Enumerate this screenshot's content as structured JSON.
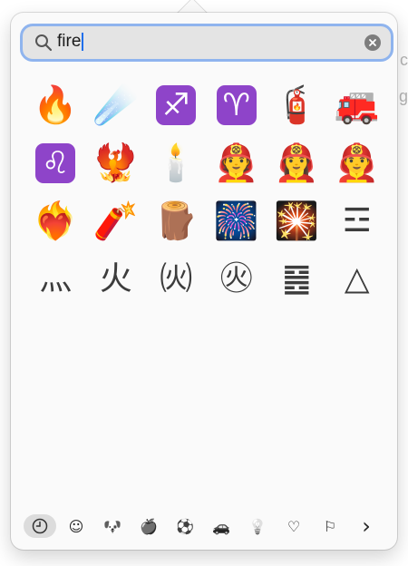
{
  "background": {
    "chars": [
      "c",
      "g"
    ]
  },
  "search": {
    "value": "fire"
  },
  "results": [
    {
      "name": "fire-emoji",
      "glyph": "🔥",
      "kind": "emoji"
    },
    {
      "name": "comet-emoji",
      "glyph": "☄️",
      "kind": "emoji"
    },
    {
      "name": "sagittarius-emoji",
      "glyph": "♐",
      "kind": "box",
      "color": "#8e44c9"
    },
    {
      "name": "aries-emoji",
      "glyph": "♈",
      "kind": "box",
      "color": "#8e44c9"
    },
    {
      "name": "fire-extinguisher-emoji",
      "glyph": "🧯",
      "kind": "emoji"
    },
    {
      "name": "fire-engine-emoji",
      "glyph": "🚒",
      "kind": "emoji"
    },
    {
      "name": "leo-emoji",
      "glyph": "♌",
      "kind": "box",
      "color": "#8e44c9"
    },
    {
      "name": "phoenix-emoji",
      "glyph": "🐦‍🔥",
      "kind": "emoji"
    },
    {
      "name": "candle-emoji",
      "glyph": "🕯️",
      "kind": "emoji"
    },
    {
      "name": "firefighter-emoji",
      "glyph": "🧑‍🚒",
      "kind": "emoji"
    },
    {
      "name": "woman-firefighter-emoji",
      "glyph": "👩‍🚒",
      "kind": "emoji"
    },
    {
      "name": "man-firefighter-emoji",
      "glyph": "👨‍🚒",
      "kind": "emoji"
    },
    {
      "name": "heart-on-fire-emoji",
      "glyph": "❤️‍🔥",
      "kind": "emoji"
    },
    {
      "name": "firecracker-emoji",
      "glyph": "🧨",
      "kind": "emoji"
    },
    {
      "name": "wood-emoji",
      "glyph": "🪵",
      "kind": "emoji"
    },
    {
      "name": "fireworks-emoji",
      "glyph": "🎆",
      "kind": "emoji"
    },
    {
      "name": "sparkler-emoji",
      "glyph": "🎇",
      "kind": "emoji"
    },
    {
      "name": "trigram-for-fire",
      "glyph": "☲",
      "kind": "sym"
    },
    {
      "name": "kangxi-radical-fire",
      "glyph": "灬",
      "kind": "sym"
    },
    {
      "name": "cjk-fire",
      "glyph": "火",
      "kind": "sym"
    },
    {
      "name": "parenthesized-fire",
      "glyph": "㈫",
      "kind": "sym"
    },
    {
      "name": "circled-fire",
      "glyph": "㊋",
      "kind": "sym"
    },
    {
      "name": "hexagram-fire",
      "glyph": "䷝",
      "kind": "sym"
    },
    {
      "name": "alchemical-fire",
      "glyph": "△",
      "kind": "sym"
    }
  ],
  "toolbar": [
    {
      "name": "recent-category-tab",
      "icon": "clock-icon",
      "active": true
    },
    {
      "name": "smileys-category-tab",
      "icon": "smiley-icon",
      "glyph": "☺"
    },
    {
      "name": "animals-category-tab",
      "icon": "dog-icon",
      "glyph": "🐶"
    },
    {
      "name": "food-category-tab",
      "icon": "apple-icon",
      "glyph": "🍎"
    },
    {
      "name": "activity-category-tab",
      "icon": "ball-icon",
      "glyph": "⚽"
    },
    {
      "name": "travel-category-tab",
      "icon": "car-icon",
      "glyph": "🚗"
    },
    {
      "name": "objects-category-tab",
      "icon": "lightbulb-icon",
      "glyph": "💡"
    },
    {
      "name": "symbols-category-tab",
      "icon": "heart-icon",
      "glyph": "♡"
    },
    {
      "name": "flags-category-tab",
      "icon": "flag-icon",
      "glyph": "⚐"
    },
    {
      "name": "more-categories-button",
      "icon": "chevron-right-icon",
      "glyph": "›"
    }
  ]
}
